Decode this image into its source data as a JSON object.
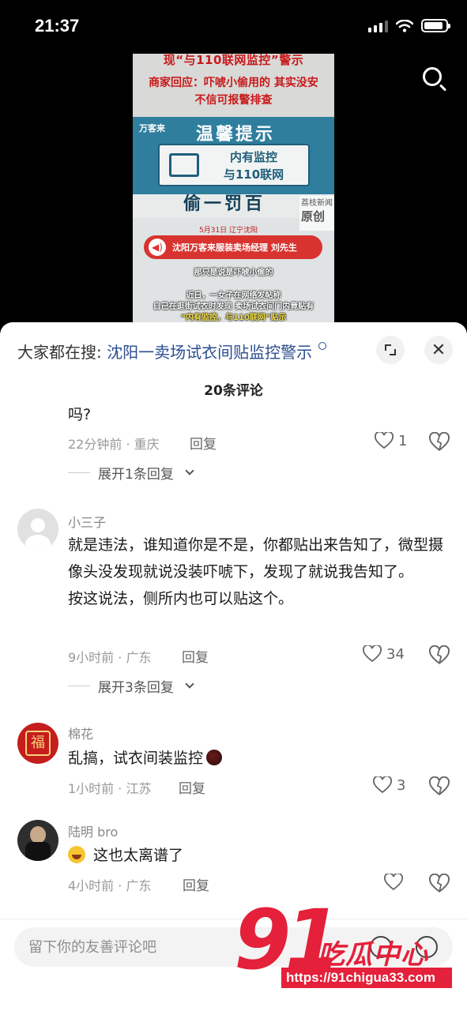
{
  "status_bar": {
    "time": "21:37",
    "battery_level": 0.9,
    "signal_bars": 3
  },
  "video": {
    "headline_line1": "现“与110联网监控”警示",
    "headline_line2": "商家回应：吓唬小偷用的 其实没安",
    "headline_line3": "不信可报警排查",
    "brand": "万客来",
    "sign_title": "温馨提示",
    "sign_line1": "内有监控",
    "sign_line2": "与110联网",
    "fine_text": "偷一罚百",
    "source_a": "荔枝新闻",
    "source_b": "原创",
    "date_location": "5月31日 辽宁沈阳",
    "speaker_label": "沈阳万客来服装卖场经理 刘先生",
    "subtitle_quote": "那只是说是吓唬小偷的",
    "subtitle_news1": "近日，一女子在网络发帖称",
    "subtitle_news2": "自己在逛街试衣时发现 卖场试衣间门内竟贴有",
    "subtitle_news3": "“内有监控，与110联网”贴示"
  },
  "sheet": {
    "search_prefix": "大家都在搜:",
    "search_query": "沈阳一卖场试衣间贴监控警示",
    "comment_count": "20条评论",
    "close_symbol": "✕"
  },
  "comments": [
    {
      "text": "吗?",
      "time": "22分钟前 · 重庆",
      "reply": "回复",
      "likes": "1",
      "expand": "展开1条回复"
    },
    {
      "user": "小三子",
      "text1": "就是违法，谁知道你是不是，你都贴出来告知了，微型摄像头没发现就说没装吓唬下，发现了就说我告知了。",
      "text2": "按这说法，侧所内也可以贴这个。",
      "time": "9小时前 · 广东",
      "reply": "回复",
      "likes": "34",
      "expand": "展开3条回复"
    },
    {
      "user": "棉花",
      "text": "乱搞，试衣间装监控",
      "time": "1小时前 · 江苏",
      "reply": "回复",
      "likes": "3"
    },
    {
      "user": "陆明 bro",
      "text": "这也太离谱了",
      "time": "4小时前 · 广东",
      "reply": "回复",
      "likes": ""
    }
  ],
  "input": {
    "placeholder": "留下你的友善评论吧"
  },
  "watermark": {
    "big": "91",
    "cn": "吃瓜中心",
    "url": "https://91chigua33.com"
  },
  "icons": {
    "search": "search-icon",
    "expand": "expand-icon",
    "close": "close-icon",
    "heart": "heart-icon",
    "dislike": "broken-heart-icon"
  },
  "colors": {
    "link": "#2a4d8f",
    "watermark": "#e4203a",
    "sheet_bg": "#ffffff"
  }
}
